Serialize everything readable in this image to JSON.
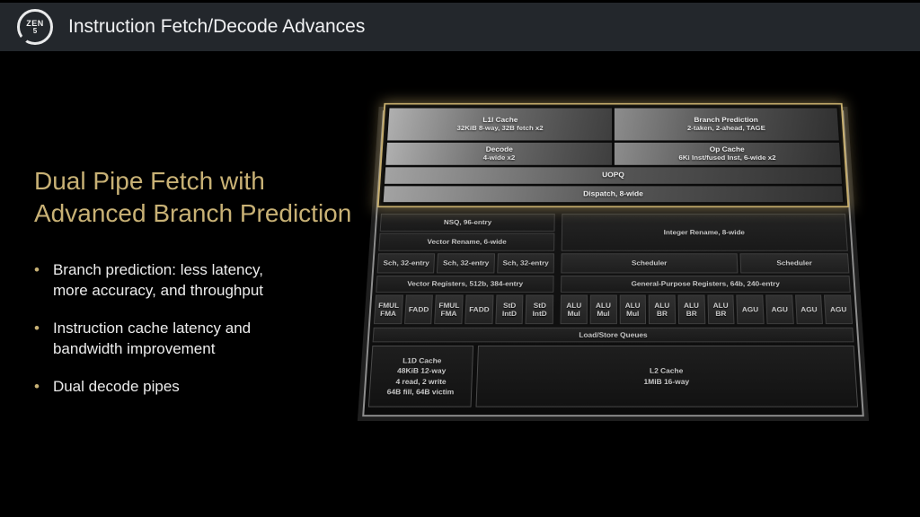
{
  "header": {
    "title": "Instruction Fetch/Decode Advances",
    "logo_top": "ZEN",
    "logo_bottom": "5"
  },
  "panel": {
    "title": "Dual Pipe Fetch with\nAdvanced Branch Prediction",
    "bullets": [
      "Branch prediction: less latency,\nmore accuracy, and throughput",
      "Instruction cache latency and\nbandwidth improvement",
      "Dual decode pipes"
    ]
  },
  "diagram": {
    "fetch_block": {
      "l1i_title": "L1I Cache",
      "l1i_sub": "32KiB 8-way, 32B fetch x2",
      "bp_title": "Branch Prediction",
      "bp_sub": "2-taken, 2-ahead, TAGE",
      "decode_title": "Decode",
      "decode_sub": "4-wide x2",
      "opcache_title": "Op Cache",
      "opcache_sub": "6Ki Inst/fused Inst, 6-wide x2",
      "uopq": "UOPQ",
      "dispatch": "Dispatch, 8-wide"
    },
    "vector_side": {
      "nsq": "NSQ, 96-entry",
      "rename": "Vector Rename, 6-wide",
      "schedulers": [
        "Sch, 32-entry",
        "Sch, 32-entry",
        "Sch, 32-entry"
      ],
      "registers": "Vector Registers, 512b, 384-entry",
      "units": [
        "FMUL\nFMA",
        "FADD",
        "FMUL\nFMA",
        "FADD",
        "StD\nIntD",
        "StD\nIntD"
      ]
    },
    "integer_side": {
      "rename": "Integer Rename, 8-wide",
      "schedulers": [
        "Scheduler",
        "Scheduler"
      ],
      "registers": "General-Purpose Registers, 64b, 240-entry",
      "units": [
        "ALU\nMul",
        "ALU\nMul",
        "ALU\nMul",
        "ALU\nBR",
        "ALU\nBR",
        "ALU\nBR",
        "AGU",
        "AGU",
        "AGU",
        "AGU"
      ]
    },
    "load_store": "Load/Store Queues",
    "l1d": "L1D Cache\n48KiB 12-way\n4 read, 2 write\n64B fill, 64B victim",
    "l2": "L2 Cache\n1MiB 16-way"
  },
  "colors": {
    "accent_gold": "#C8B175",
    "header_bg": "#23272C",
    "slide_bg": "#000000"
  }
}
